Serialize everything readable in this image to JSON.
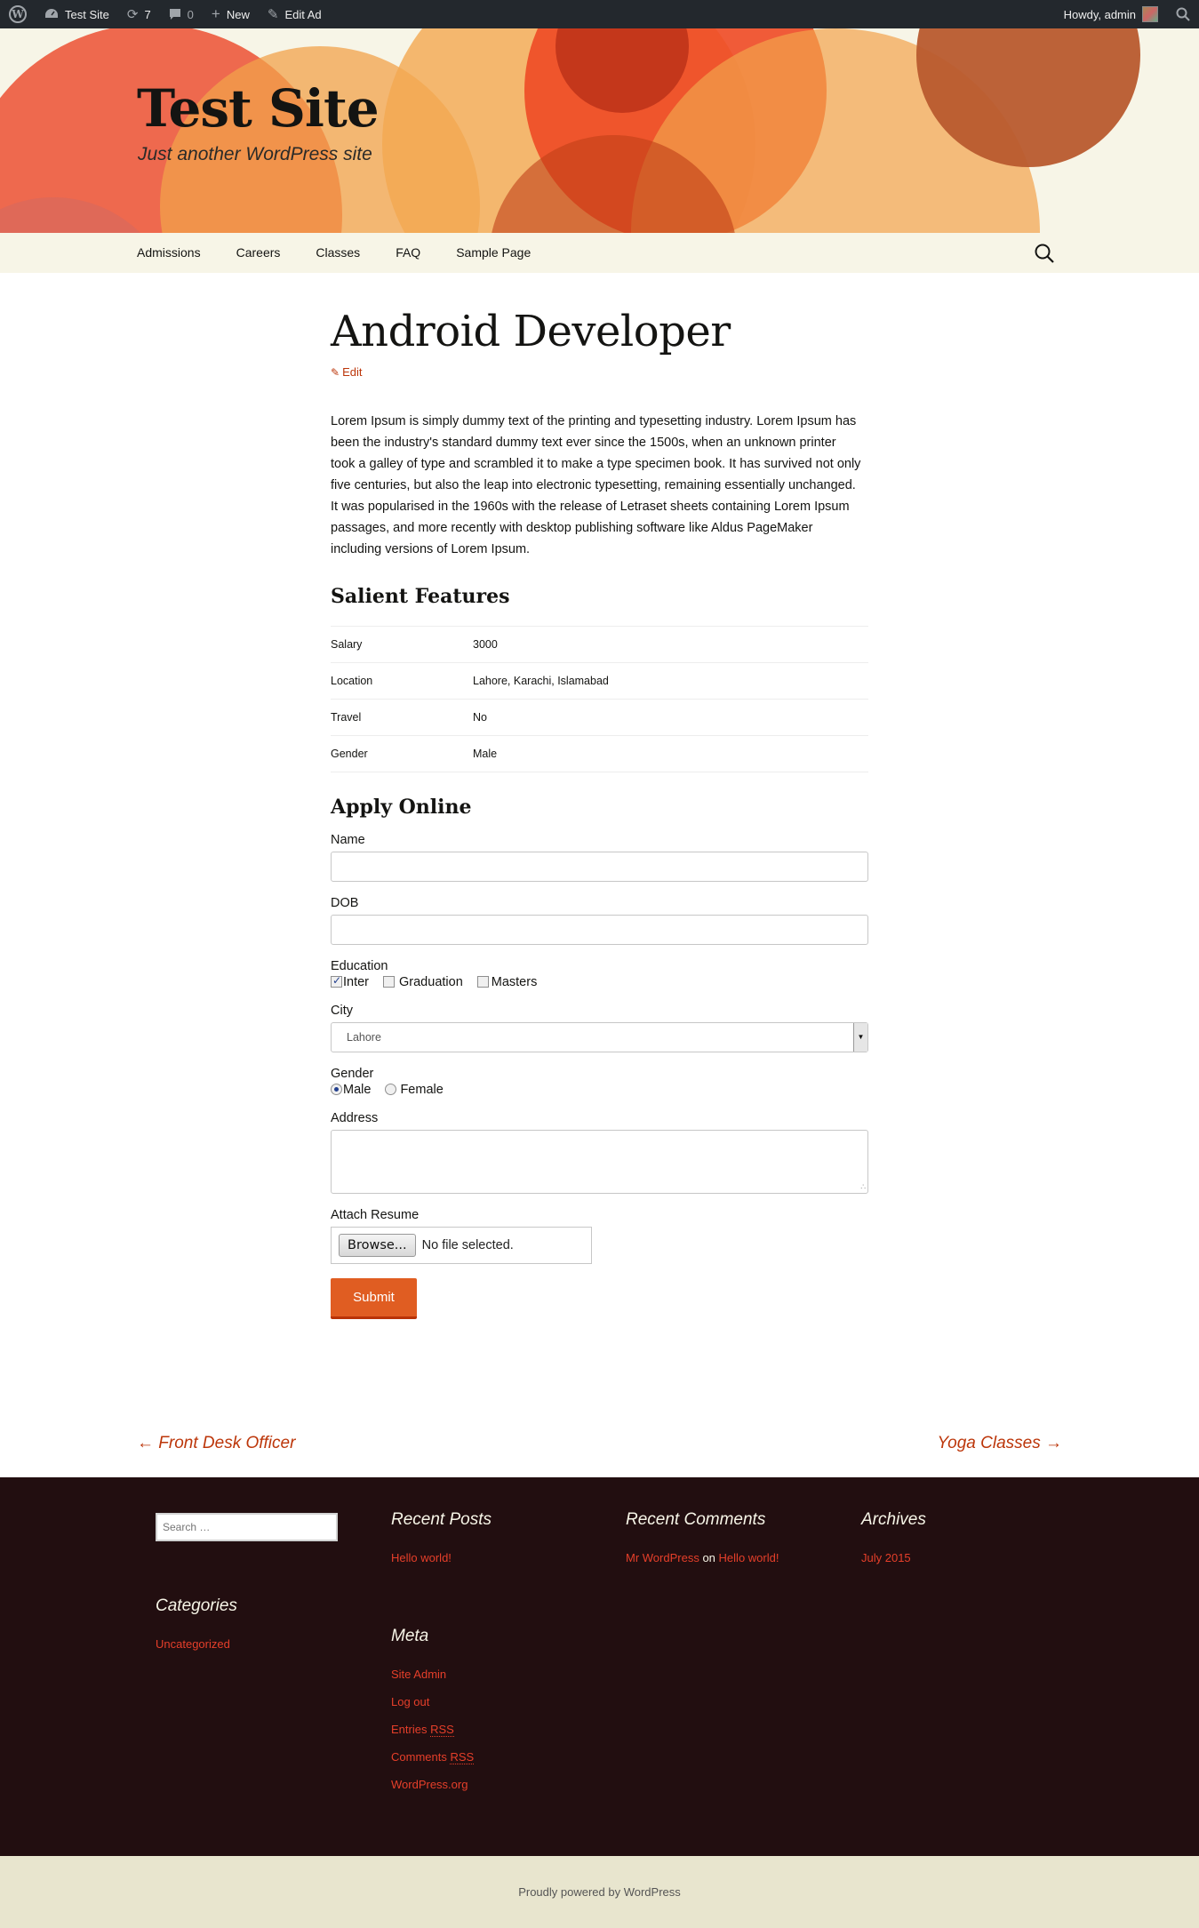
{
  "admin_bar": {
    "site_name": "Test Site",
    "updates_count": "7",
    "comments_count": "0",
    "new_label": "New",
    "edit_label": "Edit Ad",
    "greeting": "Howdy, admin"
  },
  "header": {
    "site_title": "Test Site",
    "site_description": "Just another WordPress site"
  },
  "nav": {
    "items": [
      "Admissions",
      "Careers",
      "Classes",
      "FAQ",
      "Sample Page"
    ]
  },
  "post": {
    "title": "Android Developer",
    "edit_label": "Edit",
    "body": "Lorem Ipsum is simply dummy text of the printing and typesetting industry. Lorem Ipsum has been the industry's standard dummy text ever since the 1500s, when an unknown printer took a galley of type and scrambled it to make a type specimen book. It has survived not only five centuries, but also the leap into electronic typesetting, remaining essentially unchanged. It was popularised in the 1960s with the release of Letraset sheets containing Lorem Ipsum passages, and more recently with desktop publishing software like Aldus PageMaker including versions of Lorem Ipsum."
  },
  "features": {
    "title": "Salient Features",
    "rows": [
      {
        "key": "Salary",
        "value": "3000"
      },
      {
        "key": "Location",
        "value": "Lahore, Karachi, Islamabad"
      },
      {
        "key": "Travel",
        "value": "No"
      },
      {
        "key": "Gender",
        "value": "Male"
      }
    ]
  },
  "form": {
    "title": "Apply Online",
    "name_label": "Name",
    "dob_label": "DOB",
    "education_label": "Education",
    "education_options": [
      {
        "label": "Inter",
        "checked": true
      },
      {
        "label": "Graduation",
        "checked": false
      },
      {
        "label": "Masters",
        "checked": false
      }
    ],
    "city_label": "City",
    "city_value": "Lahore",
    "gender_label": "Gender",
    "gender_options": [
      {
        "label": "Male",
        "checked": true
      },
      {
        "label": "Female",
        "checked": false
      }
    ],
    "address_label": "Address",
    "resume_label": "Attach Resume",
    "browse_label": "Browse...",
    "file_status": "No file selected.",
    "submit_label": "Submit"
  },
  "post_nav": {
    "prev": "← Front Desk Officer",
    "next": "Yoga Classes →"
  },
  "footer": {
    "search_placeholder": "Search …",
    "recent_posts_title": "Recent Posts",
    "recent_posts": [
      "Hello world!"
    ],
    "recent_comments_title": "Recent Comments",
    "recent_comment_author": "Mr WordPress",
    "recent_comment_on": "on",
    "recent_comment_post": "Hello world!",
    "archives_title": "Archives",
    "archives": [
      "July 2015"
    ],
    "categories_title": "Categories",
    "categories": [
      "Uncategorized"
    ],
    "meta_title": "Meta",
    "meta_links": [
      "Site Admin",
      "Log out",
      "Entries",
      "Comments",
      "WordPress.org"
    ],
    "rss_abbr": "RSS",
    "powered_by": "Proudly powered by WordPress"
  },
  "colors": {
    "accent": "#bc360a",
    "button": "#e05d22",
    "footer_bg": "#220e10",
    "header_bg": "#f7f5e7"
  }
}
